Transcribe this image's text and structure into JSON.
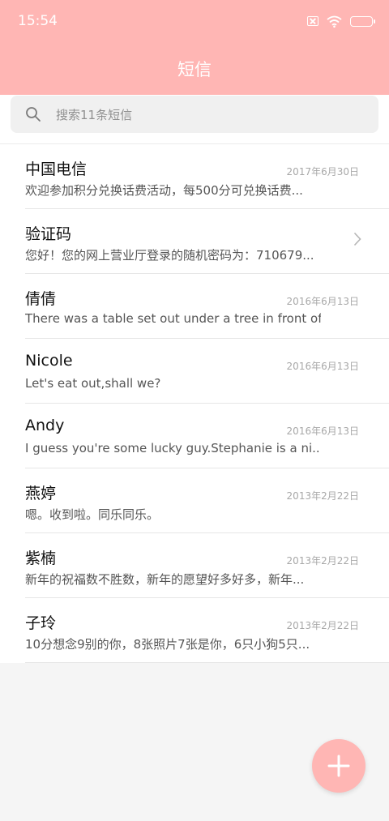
{
  "status_bar": {
    "time": "15:54",
    "icons": [
      "sim-off-icon",
      "wifi-icon",
      "battery-charging-icon"
    ]
  },
  "header": {
    "title": "短信"
  },
  "search": {
    "placeholder": "搜索11条短信"
  },
  "conversations": [
    {
      "name": "中国电信",
      "preview": "欢迎参加积分兑换话费活动，每500分可兑换话费...",
      "date": "2017年6月30日"
    },
    {
      "name": "验证码",
      "preview": "您好！您的网上营业厅登录的随机密码为：710679...",
      "date": "",
      "indicator": "chevron-right-icon"
    },
    {
      "name": "倩倩",
      "preview": "There was a table set out under a tree in front of...",
      "date": "2016年6月13日"
    },
    {
      "name": "Nicole",
      "preview": "Let's eat out,shall we?",
      "date": "2016年6月13日"
    },
    {
      "name": "Andy",
      "preview": "I guess you're some lucky guy.Stephanie is a ni...",
      "date": "2016年6月13日"
    },
    {
      "name": "燕婷",
      "preview": "嗯。收到啦。同乐同乐。",
      "date": "2013年2月22日"
    },
    {
      "name": "紫楠",
      "preview": "新年的祝福数不胜数，新年的愿望好多好多，新年...",
      "date": "2013年2月22日"
    },
    {
      "name": "子玲",
      "preview": "10分想念9别的你，8张照片7张是你，6只小狗5只...",
      "date": "2013年2月22日"
    }
  ],
  "fab": {
    "icon": "plus-icon"
  },
  "colors": {
    "accent": "#ffb6b4",
    "battery_fill": "#6bd24b",
    "date_text": "#a8a8a8"
  }
}
